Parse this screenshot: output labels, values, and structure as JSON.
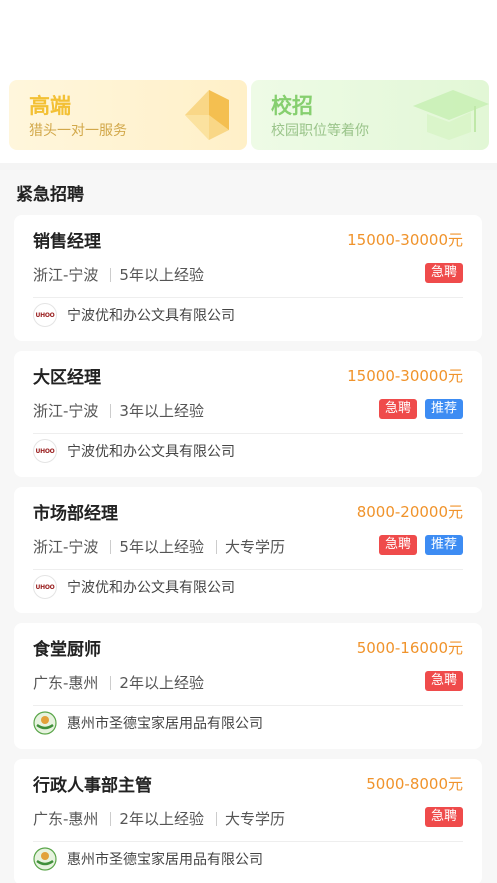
{
  "promos": [
    {
      "title": "高端",
      "subtitle": "猎头一对一服务"
    },
    {
      "title": "校招",
      "subtitle": "校园职位等着你"
    }
  ],
  "section": {
    "title": "紧急招聘"
  },
  "jobs": [
    {
      "title": "销售经理",
      "salary": "15000-30000元",
      "location": "浙江-宁波",
      "experience": "5年以上经验",
      "education": "",
      "tags": [
        "急聘"
      ],
      "company": "宁波优和办公文具有限公司",
      "logo_text": "UHOO"
    },
    {
      "title": "大区经理",
      "salary": "15000-30000元",
      "location": "浙江-宁波",
      "experience": "3年以上经验",
      "education": "",
      "tags": [
        "急聘",
        "推荐"
      ],
      "company": "宁波优和办公文具有限公司",
      "logo_text": "UHOO"
    },
    {
      "title": "市场部经理",
      "salary": "8000-20000元",
      "location": "浙江-宁波",
      "experience": "5年以上经验",
      "education": "大专学历",
      "tags": [
        "急聘",
        "推荐"
      ],
      "company": "宁波优和办公文具有限公司",
      "logo_text": "UHOO"
    },
    {
      "title": "食堂厨师",
      "salary": "5000-16000元",
      "location": "广东-惠州",
      "experience": "2年以上经验",
      "education": "",
      "tags": [
        "急聘"
      ],
      "company": "惠州市圣德宝家居用品有限公司",
      "logo_text": ""
    },
    {
      "title": "行政人事部主管",
      "salary": "5000-8000元",
      "location": "广东-惠州",
      "experience": "2年以上经验",
      "education": "大专学历",
      "tags": [
        "急聘"
      ],
      "company": "惠州市圣德宝家居用品有限公司",
      "logo_text": ""
    }
  ],
  "colors": {
    "salary": "#f0932b",
    "urgent_tag": "#ef4b4b",
    "recommend_tag": "#3d8cf3"
  }
}
